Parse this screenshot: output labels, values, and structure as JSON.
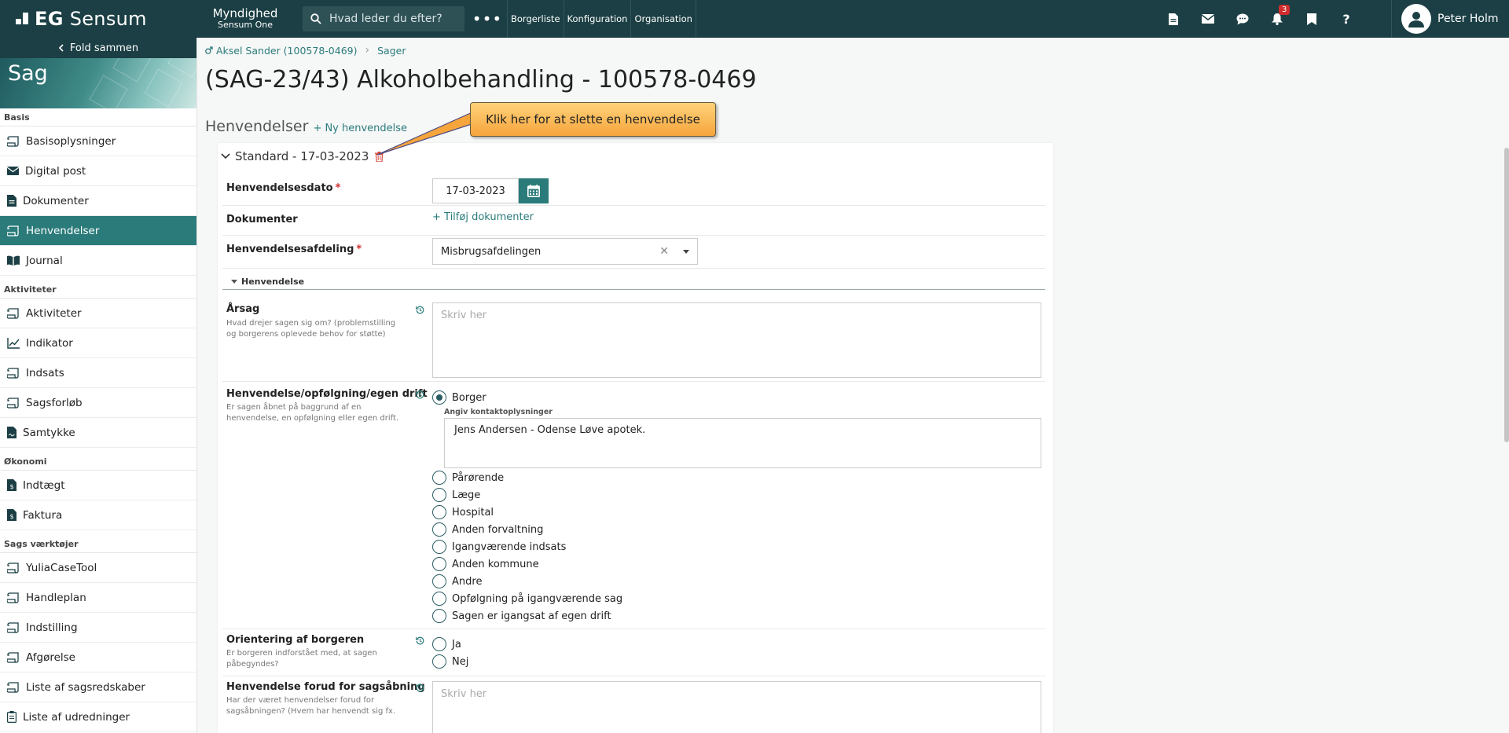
{
  "topbar": {
    "brand_bold": "EG",
    "brand_name": "Sensum",
    "app_title": "Myndighed",
    "app_subtitle": "Sensum One",
    "search_placeholder": "Hvad leder du efter?",
    "more_label": "•••",
    "nav_links": [
      "Borgerliste",
      "Konfiguration",
      "Organisation"
    ],
    "notification_count": "3",
    "user_name": "Peter Holm"
  },
  "sidebar": {
    "fold_label": "Fold sammen",
    "banner_title": "Sag",
    "sections": [
      {
        "title": "Basis",
        "items": [
          "Basisoplysninger",
          "Digital post",
          "Dokumenter",
          "Henvendelser",
          "Journal"
        ]
      },
      {
        "title": "Aktiviteter",
        "items": [
          "Aktiviteter",
          "Indikator",
          "Indsats",
          "Sagsforløb",
          "Samtykke"
        ]
      },
      {
        "title": "Økonomi",
        "items": [
          "Indtægt",
          "Faktura"
        ]
      },
      {
        "title": "Sags værktøjer",
        "items": [
          "YuliaCaseTool",
          "Handleplan",
          "Indstilling",
          "Afgørelse",
          "Liste af sagsredskaber",
          "Liste af udredninger"
        ]
      }
    ],
    "active_item": "Henvendelser"
  },
  "breadcrumb": {
    "person": "Aksel Sander (100578-0469)",
    "section": "Sager"
  },
  "page": {
    "title": "(SAG-23/43) Alkoholbehandling - 100578-0469",
    "section_title": "Henvendelser",
    "add_label": "+ Ny henvendelse",
    "callout": "Klik her for at slette en henvendelse"
  },
  "form": {
    "card_title": "Standard - 17-03-2023",
    "date_label": "Henvendelsesdato",
    "date_value": "17-03-2023",
    "docs_label": "Dokumenter",
    "add_docs_label": "+ Tilføj dokumenter",
    "dept_label": "Henvendelsesafdeling",
    "dept_value": "Misbrugsafdelingen",
    "subsection": "Henvendelse",
    "cause_label": "Årsag",
    "cause_help": "Hvad drejer sagen sig om? (problemstilling og borgerens oplevede behov for støtte)",
    "cause_placeholder": "Skriv her",
    "type_label": "Henvendelse/opfølgning/egen drift",
    "type_help": "Er sagen åbnet på baggrund af en henvendelse, en opfølgning eller egen drift.",
    "type_options": [
      "Borger",
      "Pårørende",
      "Læge",
      "Hospital",
      "Anden forvaltning",
      "Igangværende indsats",
      "Anden kommune",
      "Andre",
      "Opfølgning på igangværende sag",
      "Sagen er igangsat af egen drift"
    ],
    "type_selected": "Borger",
    "contact_label": "Angiv kontaktoplysninger",
    "contact_value": "Jens Andersen - Odense Løve apotek.",
    "orient_label": "Orientering af borgeren",
    "orient_help": "Er borgeren indforstået med, at sagen påbegyndes?",
    "orient_options": [
      "Ja",
      "Nej"
    ],
    "prior_label": "Henvendelse forud for sagsåbning",
    "prior_help": "Har der været henvendelser forud for sagsåbningen? (Hvem har henvendt sig fx.",
    "prior_placeholder": "Skriv her"
  },
  "colors": {
    "topbar": "#1b3f44",
    "accent": "#2a7b7a",
    "callout": "#f6a53c",
    "required": "#d12d2d"
  }
}
